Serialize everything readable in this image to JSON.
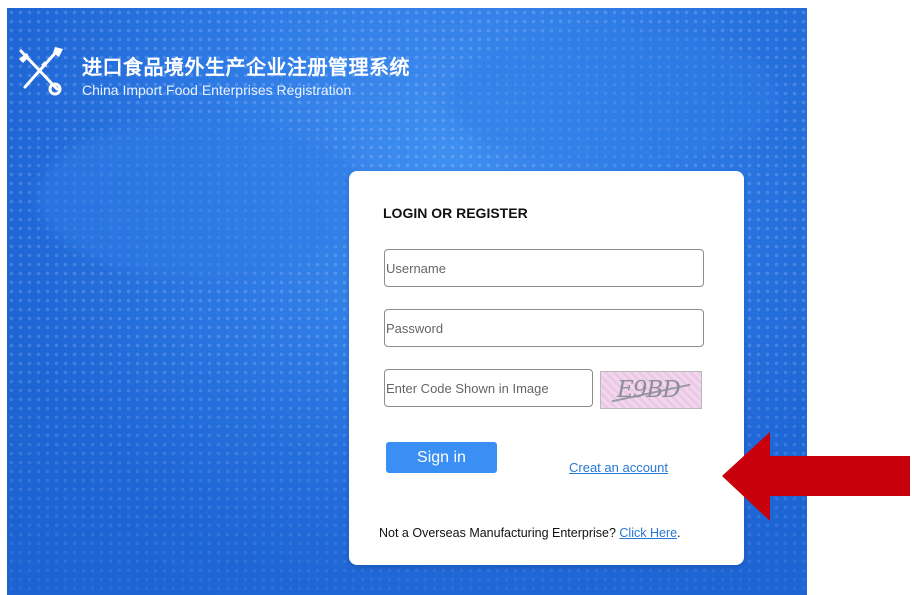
{
  "header": {
    "title_cn": "进口食品境外生产企业注册管理系统",
    "title_en": "China Import Food Enterprises Registration"
  },
  "login_card": {
    "title": "LOGIN OR REGISTER",
    "username_placeholder": "Username",
    "password_placeholder": "Password",
    "code_placeholder": "Enter Code Shown in Image",
    "captcha_text": "E9BD",
    "signin_label": "Sign in",
    "create_account_label": "Creat an account",
    "not_manufacturer_prefix": "Not a Overseas Manufacturing Enterprise? ",
    "click_here_label": "Click Here",
    "not_manufacturer_suffix": "."
  },
  "colors": {
    "background_blue": "#2f7ce6",
    "button_blue": "#3a8ff4",
    "link_blue": "#2878d6",
    "annotation_arrow": "#c8000c"
  },
  "icons": {
    "logo": "crossed-tools-icon",
    "annotation": "left-arrow-icon"
  }
}
